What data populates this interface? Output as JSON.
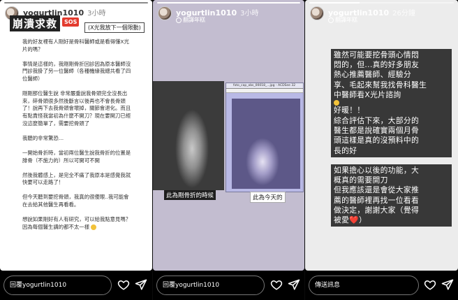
{
  "panels": [
    {
      "username": "yogurtlin1010",
      "time": "3小時",
      "title": "崩潰求救",
      "sos_badge": "SOS",
      "next_note": "(X光我放下一個限動)",
      "body_paragraphs": [
        "我的好友裡有人剛好是骨科醫師或是看得懂X光片的嗎？",
        "事情是這樣的，我剛剛骨折回診因為原本醫師沒門診我掛了另一位醫師（各種機緣我總共看了四位醫師）",
        "剛剛那位醫生說 非常嚴重說我骨頭完全沒長出來，碎骨頭很多然後斷言以後再也不會長骨頭了！說再下去我骨頭會壞掉，關節會退化。而且有點責怪我當初為什麼不開刀？現在要開刀已經沒這麼簡單了，需要挖骨頭了",
        "我聽的非常驚恐…",
        "一開始骨折時，當初兩位醫生說我骨折的位置是腓骨（不施力的）所以可開可不開",
        "然後我體感上，是完全不痛了我原本是感覺我就快要可以走路了！",
        "但今天聽到要挖骨頭，我真的很傻眼..我可能會在去給其他醫生再看看。",
        "想說如果剛好有人有研究，可以給我點意見嗎？因為每個醫生講的都不太一樣"
      ],
      "reply_placeholder": "回覆yogurtlin1010"
    },
    {
      "username": "yogurtlin1010",
      "time": "3小時",
      "translate_label": "翻譯年糕",
      "window_title": "foto_cap_obs_00018_...jpg - ACDSee 32",
      "caption_left": "此為剛骨折的時候",
      "caption_right": "此為今天的",
      "reply_placeholder": "回覆yogurtlin1010"
    },
    {
      "username": "yogurtlin1010",
      "time": "26分鐘",
      "translate_label": "翻譯年糕",
      "box_a_lines": [
        "雖然可能要挖骨頭心情悶",
        "悶的，但...真的好多朋友",
        "熱心推薦醫師、經驗分",
        "享、毛起來幫我找骨科醫生",
        "中醫師看X光片諮詢",
        "好暖！！"
      ],
      "box_b_lines": [
        "綜合評估下來，大部分的",
        "醫生都是說確實兩個月骨",
        "頭這樣是真的沒預料中的",
        "長的好"
      ],
      "box_c_lines": [
        "如果擔心以後的功能，大",
        "概真的需要開刀",
        "但我應該還是會從大家推",
        "薦的醫師裡再找一位看看",
        "做決定，謝謝大家（覺得",
        "被愛"
      ],
      "heart_glyph": "❤️",
      "close_paren": "）",
      "reply_placeholder": "傳送訊息"
    }
  ],
  "icons": {
    "like": "heart-outline-icon",
    "send": "paper-plane-icon"
  },
  "colors": {
    "text_box": "#383838",
    "sos": "#e33b2e"
  }
}
